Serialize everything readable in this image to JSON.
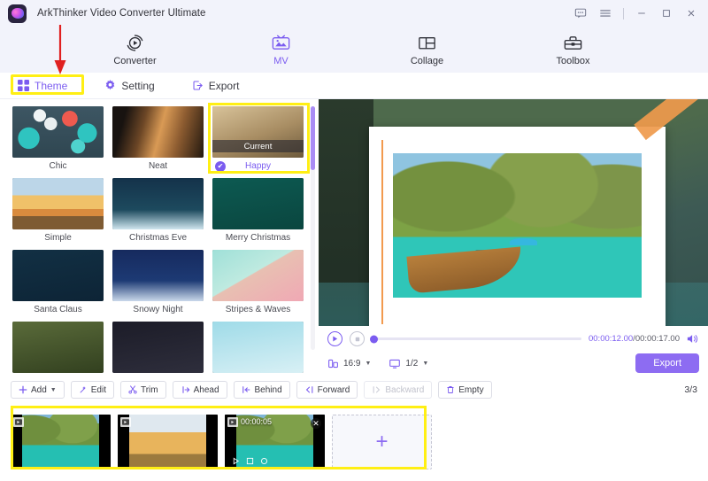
{
  "window": {
    "title": "ArkThinker Video Converter Ultimate",
    "controls": [
      {
        "name": "feedback-icon",
        "label": "Feedback"
      },
      {
        "name": "menu-icon",
        "label": "Menu"
      },
      {
        "name": "minimize-icon",
        "label": "Minimize"
      },
      {
        "name": "maximize-icon",
        "label": "Maximize"
      },
      {
        "name": "close-icon",
        "label": "Close"
      }
    ]
  },
  "mainnav": {
    "items": [
      {
        "label": "Converter",
        "icon": "converter-icon",
        "active": false
      },
      {
        "label": "MV",
        "icon": "mv-icon",
        "active": true
      },
      {
        "label": "Collage",
        "icon": "collage-icon",
        "active": false
      },
      {
        "label": "Toolbox",
        "icon": "toolbox-icon",
        "active": false
      }
    ]
  },
  "subtabs": {
    "items": [
      {
        "label": "Theme",
        "icon": "grid-icon",
        "active": true
      },
      {
        "label": "Setting",
        "icon": "gear-icon",
        "active": false
      },
      {
        "label": "Export",
        "icon": "export-icon",
        "active": false
      }
    ]
  },
  "themes": {
    "items": [
      {
        "name": "Chic",
        "art": "art-chic",
        "selected": false
      },
      {
        "name": "Neat",
        "art": "art-neat",
        "selected": false
      },
      {
        "name": "Happy",
        "art": "art-happy",
        "selected": true,
        "badge": "Current"
      },
      {
        "name": "Simple",
        "art": "art-simple",
        "selected": false
      },
      {
        "name": "Christmas Eve",
        "art": "art-xmaseve",
        "selected": false
      },
      {
        "name": "Merry Christmas",
        "art": "art-merry",
        "selected": false
      },
      {
        "name": "Santa Claus",
        "art": "art-santa",
        "selected": false
      },
      {
        "name": "Snowy Night",
        "art": "art-snowy",
        "selected": false
      },
      {
        "name": "Stripes & Waves",
        "art": "art-stripes",
        "selected": false
      },
      {
        "name": "",
        "art": "art-row4a",
        "selected": false
      },
      {
        "name": "",
        "art": "art-row4b",
        "selected": false
      },
      {
        "name": "",
        "art": "art-row4c",
        "selected": false
      }
    ]
  },
  "player": {
    "current_time": "00:00:12.00",
    "separator": "/",
    "total_time": "00:00:17.00",
    "aspect_ratio": "16:9",
    "quality": "1/2",
    "export_label": "Export",
    "progress_percent": 0
  },
  "toolbar": {
    "buttons": [
      {
        "label": "Add",
        "icon": "plus-icon",
        "dropdown": true,
        "disabled": false
      },
      {
        "label": "Edit",
        "icon": "wand-icon",
        "dropdown": false,
        "disabled": false
      },
      {
        "label": "Trim",
        "icon": "scissors-icon",
        "dropdown": false,
        "disabled": false
      },
      {
        "label": "Ahead",
        "icon": "insert-ahead-icon",
        "dropdown": false,
        "disabled": false
      },
      {
        "label": "Behind",
        "icon": "insert-behind-icon",
        "dropdown": false,
        "disabled": false
      },
      {
        "label": "Forward",
        "icon": "move-forward-icon",
        "dropdown": false,
        "disabled": false
      },
      {
        "label": "Backward",
        "icon": "move-backward-icon",
        "dropdown": false,
        "disabled": true
      },
      {
        "label": "Empty",
        "icon": "trash-icon",
        "dropdown": false,
        "disabled": false
      }
    ],
    "counter": "3/3"
  },
  "timeline": {
    "clips": [
      {
        "art": "clip-art-a",
        "selected": false,
        "duration": "",
        "badge": "video-badge"
      },
      {
        "art": "clip-art-b",
        "selected": false,
        "duration": "",
        "badge": "video-badge"
      },
      {
        "art": "clip-art-a",
        "selected": true,
        "duration": "00:00:05",
        "badge": "video-badge"
      }
    ],
    "add_label": "+"
  },
  "colors": {
    "accent": "#7b5cf0",
    "accent_button": "#8d6cf2",
    "highlight": "#ffef14",
    "annotation_arrow": "#e02020",
    "titlebar_bg": "#f2f3fb"
  }
}
